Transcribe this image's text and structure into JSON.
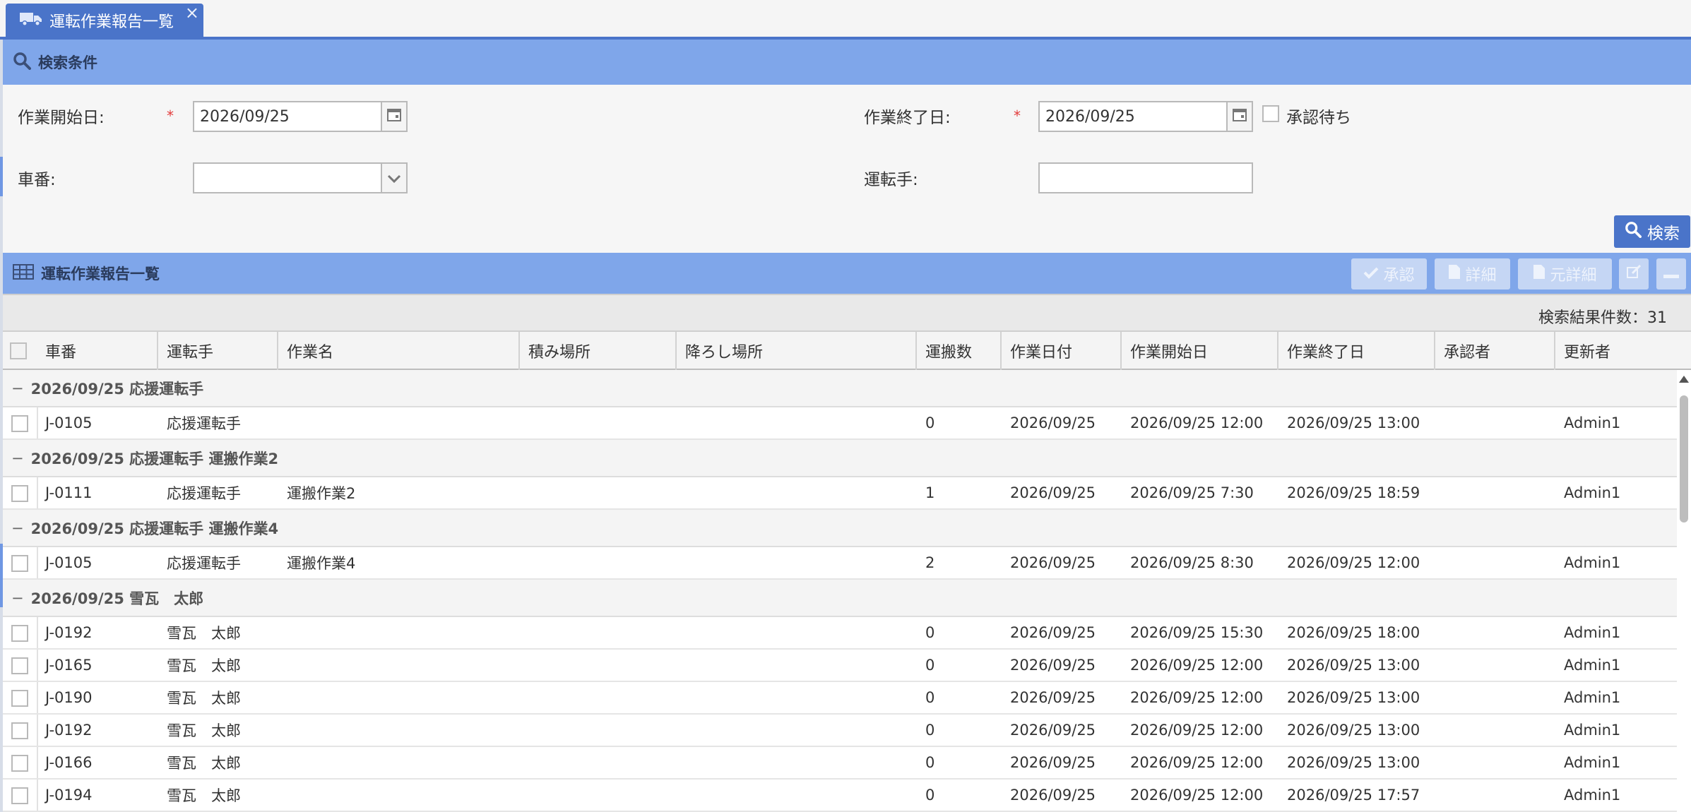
{
  "tab": {
    "label": "運転作業報告一覧",
    "icon": "truck-icon",
    "close": "×"
  },
  "search_section": {
    "title": "検索条件",
    "start_date_label": "作業開始日:",
    "start_date_value": "2026/09/25",
    "end_date_label": "作業終了日:",
    "end_date_value": "2026/09/25",
    "pending_label": "承認待ち",
    "vehicle_label": "車番:",
    "vehicle_value": "",
    "driver_label": "運転手:",
    "driver_value": "",
    "required_mark": "*",
    "search_button": "検索"
  },
  "list_section": {
    "title": "運転作業報告一覧",
    "toolbar": {
      "approve": "承認",
      "detail": "詳細",
      "source_detail": "元詳細"
    },
    "result_count": "検索結果件数：31"
  },
  "columns": [
    "車番",
    "運転手",
    "作業名",
    "積み場所",
    "降ろし場所",
    "運搬数",
    "作業日付",
    "作業開始日",
    "作業終了日",
    "承認者",
    "更新者"
  ],
  "rows": [
    {
      "type": "group",
      "label": "2026/09/25 応援運転手",
      "toggle": "−"
    },
    {
      "type": "data",
      "vehicle": "J-0105",
      "driver": "応援運転手",
      "work": "",
      "load": "",
      "unload": "",
      "count": "0",
      "date": "2026/09/25",
      "start": "2026/09/25 12:00",
      "end": "2026/09/25 13:00",
      "approver": "",
      "updater": "Admin1"
    },
    {
      "type": "group",
      "label": "2026/09/25 応援運転手 運搬作業2",
      "toggle": "−"
    },
    {
      "type": "data",
      "vehicle": "J-0111",
      "driver": "応援運転手",
      "work": "運搬作業2",
      "load": "",
      "unload": "",
      "count": "1",
      "date": "2026/09/25",
      "start": "2026/09/25 7:30",
      "end": "2026/09/25 18:59",
      "approver": "",
      "updater": "Admin1"
    },
    {
      "type": "group",
      "label": "2026/09/25 応援運転手 運搬作業4",
      "toggle": "−"
    },
    {
      "type": "data",
      "vehicle": "J-0105",
      "driver": "応援運転手",
      "work": "運搬作業4",
      "load": "",
      "unload": "",
      "count": "2",
      "date": "2026/09/25",
      "start": "2026/09/25 8:30",
      "end": "2026/09/25 12:00",
      "approver": "",
      "updater": "Admin1"
    },
    {
      "type": "group",
      "label": "2026/09/25 雪瓦　太郎",
      "toggle": "−"
    },
    {
      "type": "data",
      "vehicle": "J-0192",
      "driver": "雪瓦　太郎",
      "work": "",
      "load": "",
      "unload": "",
      "count": "0",
      "date": "2026/09/25",
      "start": "2026/09/25 15:30",
      "end": "2026/09/25 18:00",
      "approver": "",
      "updater": "Admin1"
    },
    {
      "type": "data",
      "vehicle": "J-0165",
      "driver": "雪瓦　太郎",
      "work": "",
      "load": "",
      "unload": "",
      "count": "0",
      "date": "2026/09/25",
      "start": "2026/09/25 12:00",
      "end": "2026/09/25 13:00",
      "approver": "",
      "updater": "Admin1"
    },
    {
      "type": "data",
      "vehicle": "J-0190",
      "driver": "雪瓦　太郎",
      "work": "",
      "load": "",
      "unload": "",
      "count": "0",
      "date": "2026/09/25",
      "start": "2026/09/25 12:00",
      "end": "2026/09/25 13:00",
      "approver": "",
      "updater": "Admin1"
    },
    {
      "type": "data",
      "vehicle": "J-0192",
      "driver": "雪瓦　太郎",
      "work": "",
      "load": "",
      "unload": "",
      "count": "0",
      "date": "2026/09/25",
      "start": "2026/09/25 12:00",
      "end": "2026/09/25 13:00",
      "approver": "",
      "updater": "Admin1"
    },
    {
      "type": "data",
      "vehicle": "J-0166",
      "driver": "雪瓦　太郎",
      "work": "",
      "load": "",
      "unload": "",
      "count": "0",
      "date": "2026/09/25",
      "start": "2026/09/25 12:00",
      "end": "2026/09/25 13:00",
      "approver": "",
      "updater": "Admin1"
    },
    {
      "type": "data",
      "vehicle": "J-0194",
      "driver": "雪瓦　太郎",
      "work": "",
      "load": "",
      "unload": "",
      "count": "0",
      "date": "2026/09/25",
      "start": "2026/09/25 12:00",
      "end": "2026/09/25 17:57",
      "approver": "",
      "updater": "Admin1"
    }
  ],
  "colors": {
    "accent": "#4a74c9",
    "section_bar": "#7fa6ea",
    "required": "#e23b3b"
  }
}
